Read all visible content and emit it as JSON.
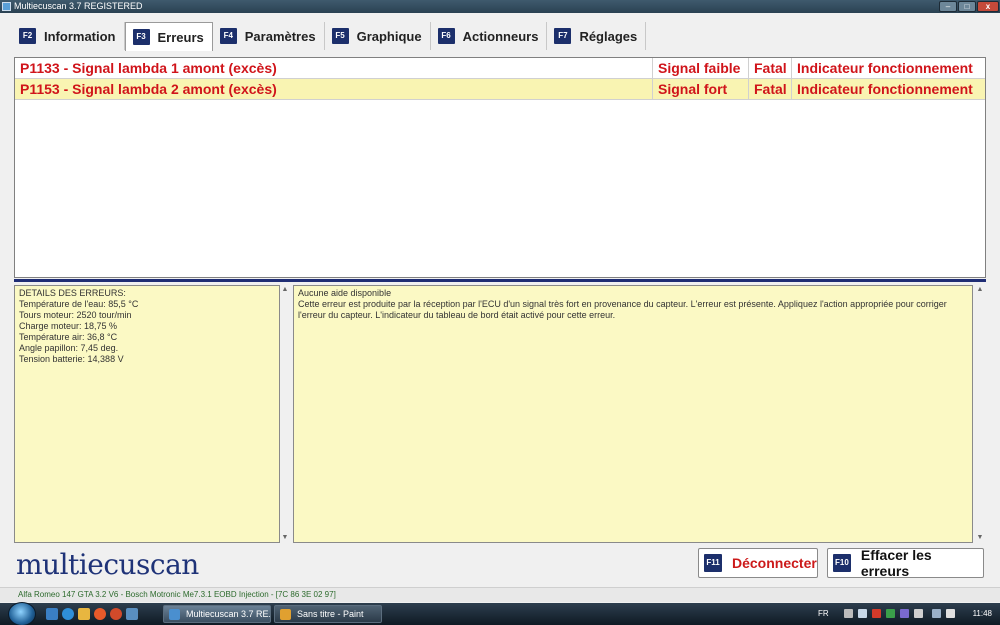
{
  "window": {
    "title": "Multiecuscan 3.7 REGISTERED",
    "controls": {
      "minimize": "–",
      "maximize": "□",
      "close": "x"
    }
  },
  "tabs": [
    {
      "key": "F2",
      "label": "Information",
      "active": false
    },
    {
      "key": "F3",
      "label": "Erreurs",
      "active": true
    },
    {
      "key": "F4",
      "label": "Paramètres",
      "active": false
    },
    {
      "key": "F5",
      "label": "Graphique",
      "active": false
    },
    {
      "key": "F6",
      "label": "Actionneurs",
      "active": false
    },
    {
      "key": "F7",
      "label": "Réglages",
      "active": false
    }
  ],
  "errors": [
    {
      "code": "P1133 - Signal lambda 1 amont (excès)",
      "type": "Signal faible",
      "severity": "Fatal",
      "indicator": "Indicateur fonctionnement"
    },
    {
      "code": "P1153 - Signal lambda 2 amont (excès)",
      "type": "Signal fort",
      "severity": "Fatal",
      "indicator": "Indicateur fonctionnement",
      "selected": true
    }
  ],
  "details": {
    "lines": [
      "DETAILS DES ERREURS:",
      "Température de l'eau: 85,5 °C",
      "Tours moteur: 2520 tour/min",
      "Charge moteur: 18,75 %",
      "Température air: 36,8 °C",
      "Angle papillon: 7,45 deg.",
      "Tension batterie: 14,388 V"
    ]
  },
  "help": {
    "title": "Aucune aide disponible",
    "text": "Cette erreur est produite par la réception par l'ECU d'un signal très fort en provenance du capteur. L'erreur est présente. Appliquez l'action appropriée pour corriger l'erreur du capteur. L'indicateur du tableau de bord était activé pour cette erreur."
  },
  "logo": "multiecuscan",
  "buttons": {
    "disconnect": {
      "key": "F11",
      "label": "Déconnecter"
    },
    "clear": {
      "key": "F10",
      "label": "Effacer les erreurs"
    }
  },
  "statusbar": "Alfa Romeo 147 GTA 3.2 V6 - Bosch Motronic Me7.3.1 EOBD Injection - [7C 86 3E 02 97]",
  "taskbar": {
    "items": [
      {
        "label": "Multiecuscan 3.7 RE...",
        "icon_color": "#4a8fcf"
      },
      {
        "label": "Sans titre - Paint",
        "icon_color": "#e0a030"
      }
    ],
    "language": "FR",
    "clock": "11:48"
  },
  "colors": {
    "error_text": "#d0141a",
    "selected_row": "#f9f4b2",
    "panel_bg": "#fbf9c4",
    "fkey_bg": "#1c2f6b",
    "logo": "#1f3378",
    "status_text": "#2c6a2c"
  }
}
